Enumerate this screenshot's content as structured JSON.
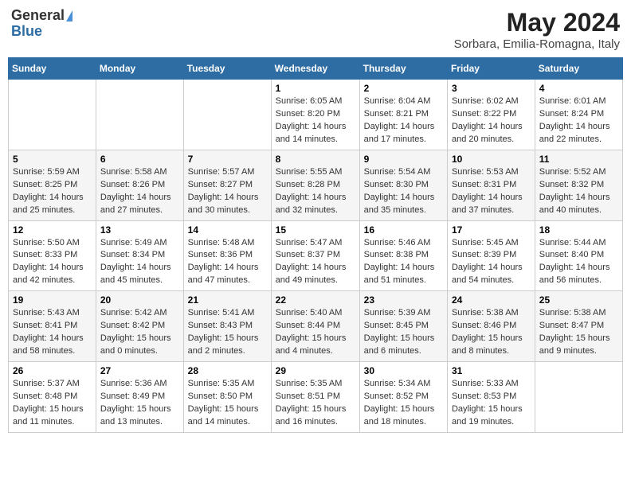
{
  "header": {
    "logo_general": "General",
    "logo_blue": "Blue",
    "title": "May 2024",
    "subtitle": "Sorbara, Emilia-Romagna, Italy"
  },
  "weekdays": [
    "Sunday",
    "Monday",
    "Tuesday",
    "Wednesday",
    "Thursday",
    "Friday",
    "Saturday"
  ],
  "weeks": [
    [
      {
        "day": "",
        "sunrise": "",
        "sunset": "",
        "daylight": ""
      },
      {
        "day": "",
        "sunrise": "",
        "sunset": "",
        "daylight": ""
      },
      {
        "day": "",
        "sunrise": "",
        "sunset": "",
        "daylight": ""
      },
      {
        "day": "1",
        "sunrise": "Sunrise: 6:05 AM",
        "sunset": "Sunset: 8:20 PM",
        "daylight": "Daylight: 14 hours and 14 minutes."
      },
      {
        "day": "2",
        "sunrise": "Sunrise: 6:04 AM",
        "sunset": "Sunset: 8:21 PM",
        "daylight": "Daylight: 14 hours and 17 minutes."
      },
      {
        "day": "3",
        "sunrise": "Sunrise: 6:02 AM",
        "sunset": "Sunset: 8:22 PM",
        "daylight": "Daylight: 14 hours and 20 minutes."
      },
      {
        "day": "4",
        "sunrise": "Sunrise: 6:01 AM",
        "sunset": "Sunset: 8:24 PM",
        "daylight": "Daylight: 14 hours and 22 minutes."
      }
    ],
    [
      {
        "day": "5",
        "sunrise": "Sunrise: 5:59 AM",
        "sunset": "Sunset: 8:25 PM",
        "daylight": "Daylight: 14 hours and 25 minutes."
      },
      {
        "day": "6",
        "sunrise": "Sunrise: 5:58 AM",
        "sunset": "Sunset: 8:26 PM",
        "daylight": "Daylight: 14 hours and 27 minutes."
      },
      {
        "day": "7",
        "sunrise": "Sunrise: 5:57 AM",
        "sunset": "Sunset: 8:27 PM",
        "daylight": "Daylight: 14 hours and 30 minutes."
      },
      {
        "day": "8",
        "sunrise": "Sunrise: 5:55 AM",
        "sunset": "Sunset: 8:28 PM",
        "daylight": "Daylight: 14 hours and 32 minutes."
      },
      {
        "day": "9",
        "sunrise": "Sunrise: 5:54 AM",
        "sunset": "Sunset: 8:30 PM",
        "daylight": "Daylight: 14 hours and 35 minutes."
      },
      {
        "day": "10",
        "sunrise": "Sunrise: 5:53 AM",
        "sunset": "Sunset: 8:31 PM",
        "daylight": "Daylight: 14 hours and 37 minutes."
      },
      {
        "day": "11",
        "sunrise": "Sunrise: 5:52 AM",
        "sunset": "Sunset: 8:32 PM",
        "daylight": "Daylight: 14 hours and 40 minutes."
      }
    ],
    [
      {
        "day": "12",
        "sunrise": "Sunrise: 5:50 AM",
        "sunset": "Sunset: 8:33 PM",
        "daylight": "Daylight: 14 hours and 42 minutes."
      },
      {
        "day": "13",
        "sunrise": "Sunrise: 5:49 AM",
        "sunset": "Sunset: 8:34 PM",
        "daylight": "Daylight: 14 hours and 45 minutes."
      },
      {
        "day": "14",
        "sunrise": "Sunrise: 5:48 AM",
        "sunset": "Sunset: 8:36 PM",
        "daylight": "Daylight: 14 hours and 47 minutes."
      },
      {
        "day": "15",
        "sunrise": "Sunrise: 5:47 AM",
        "sunset": "Sunset: 8:37 PM",
        "daylight": "Daylight: 14 hours and 49 minutes."
      },
      {
        "day": "16",
        "sunrise": "Sunrise: 5:46 AM",
        "sunset": "Sunset: 8:38 PM",
        "daylight": "Daylight: 14 hours and 51 minutes."
      },
      {
        "day": "17",
        "sunrise": "Sunrise: 5:45 AM",
        "sunset": "Sunset: 8:39 PM",
        "daylight": "Daylight: 14 hours and 54 minutes."
      },
      {
        "day": "18",
        "sunrise": "Sunrise: 5:44 AM",
        "sunset": "Sunset: 8:40 PM",
        "daylight": "Daylight: 14 hours and 56 minutes."
      }
    ],
    [
      {
        "day": "19",
        "sunrise": "Sunrise: 5:43 AM",
        "sunset": "Sunset: 8:41 PM",
        "daylight": "Daylight: 14 hours and 58 minutes."
      },
      {
        "day": "20",
        "sunrise": "Sunrise: 5:42 AM",
        "sunset": "Sunset: 8:42 PM",
        "daylight": "Daylight: 15 hours and 0 minutes."
      },
      {
        "day": "21",
        "sunrise": "Sunrise: 5:41 AM",
        "sunset": "Sunset: 8:43 PM",
        "daylight": "Daylight: 15 hours and 2 minutes."
      },
      {
        "day": "22",
        "sunrise": "Sunrise: 5:40 AM",
        "sunset": "Sunset: 8:44 PM",
        "daylight": "Daylight: 15 hours and 4 minutes."
      },
      {
        "day": "23",
        "sunrise": "Sunrise: 5:39 AM",
        "sunset": "Sunset: 8:45 PM",
        "daylight": "Daylight: 15 hours and 6 minutes."
      },
      {
        "day": "24",
        "sunrise": "Sunrise: 5:38 AM",
        "sunset": "Sunset: 8:46 PM",
        "daylight": "Daylight: 15 hours and 8 minutes."
      },
      {
        "day": "25",
        "sunrise": "Sunrise: 5:38 AM",
        "sunset": "Sunset: 8:47 PM",
        "daylight": "Daylight: 15 hours and 9 minutes."
      }
    ],
    [
      {
        "day": "26",
        "sunrise": "Sunrise: 5:37 AM",
        "sunset": "Sunset: 8:48 PM",
        "daylight": "Daylight: 15 hours and 11 minutes."
      },
      {
        "day": "27",
        "sunrise": "Sunrise: 5:36 AM",
        "sunset": "Sunset: 8:49 PM",
        "daylight": "Daylight: 15 hours and 13 minutes."
      },
      {
        "day": "28",
        "sunrise": "Sunrise: 5:35 AM",
        "sunset": "Sunset: 8:50 PM",
        "daylight": "Daylight: 15 hours and 14 minutes."
      },
      {
        "day": "29",
        "sunrise": "Sunrise: 5:35 AM",
        "sunset": "Sunset: 8:51 PM",
        "daylight": "Daylight: 15 hours and 16 minutes."
      },
      {
        "day": "30",
        "sunrise": "Sunrise: 5:34 AM",
        "sunset": "Sunset: 8:52 PM",
        "daylight": "Daylight: 15 hours and 18 minutes."
      },
      {
        "day": "31",
        "sunrise": "Sunrise: 5:33 AM",
        "sunset": "Sunset: 8:53 PM",
        "daylight": "Daylight: 15 hours and 19 minutes."
      },
      {
        "day": "",
        "sunrise": "",
        "sunset": "",
        "daylight": ""
      }
    ]
  ]
}
